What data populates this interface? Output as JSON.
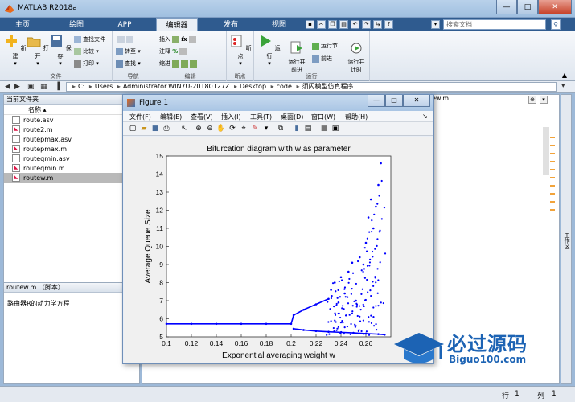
{
  "window": {
    "title": "MATLAB R2018a",
    "minimize": "—",
    "maximize": "□",
    "close": "✕"
  },
  "tabs": [
    {
      "label": "主页"
    },
    {
      "label": "绘图"
    },
    {
      "label": "APP"
    },
    {
      "label": "编辑器"
    },
    {
      "label": "发布"
    },
    {
      "label": "视图"
    }
  ],
  "search": {
    "placeholder": "搜索文档"
  },
  "ribbon": {
    "file": {
      "title": "文件",
      "new": "新建",
      "open": "打开",
      "save": "保存",
      "find_files": "查找文件",
      "compare": "比较",
      "print": "打印"
    },
    "nav": {
      "title": "导航",
      "goto": "转至",
      "find": "查找"
    },
    "edit": {
      "title": "编辑",
      "insert": "插入",
      "comment": "注释",
      "indent": "缩进",
      "fx": "fx"
    },
    "breakpoints": {
      "title": "断点",
      "label": "断点"
    },
    "run": {
      "title": "运行",
      "run": "运行",
      "run_advance": "运行并\n前进",
      "run_section": "运行节",
      "advance": "前进",
      "run_time": "运行并\n计时"
    }
  },
  "path": {
    "segments": [
      "C:",
      "Users",
      "Administrator.WIN7U-20180127Z",
      "Desktop",
      "code",
      "须闪模型仿真程序"
    ]
  },
  "current_folder": {
    "title": "当前文件夹",
    "column": "名称",
    "files": [
      {
        "name": "route.asv",
        "type": "asv"
      },
      {
        "name": "route2.m",
        "type": "m"
      },
      {
        "name": "routepmax.asv",
        "type": "asv"
      },
      {
        "name": "routepmax.m",
        "type": "m"
      },
      {
        "name": "routeqmin.asv",
        "type": "asv"
      },
      {
        "name": "routeqmin.m",
        "type": "m"
      },
      {
        "name": "routew.m",
        "type": "m"
      }
    ],
    "detail_title": "routew.m （脚本）",
    "detail_text": "路由器R的动力学方程"
  },
  "editor": {
    "tab": "ew.m"
  },
  "right_strip": "工作区",
  "status": {
    "row_label": "行",
    "row": "1",
    "col_label": "列",
    "col": "1"
  },
  "figure": {
    "title": "Figure 1",
    "menu": [
      "文件(F)",
      "编辑(E)",
      "查看(V)",
      "插入(I)",
      "工具(T)",
      "桌面(D)",
      "窗口(W)",
      "帮助(H)"
    ]
  },
  "chart_data": {
    "type": "scatter",
    "title": "Bifurcation diagram with w as parameter",
    "xlabel": "Exponential averaging weight w",
    "ylabel": "Average Queue Size",
    "xlim": [
      0.1,
      0.28
    ],
    "ylim": [
      5,
      15
    ],
    "xticks": [
      "0.1",
      "0.12",
      "0.14",
      "0.16",
      "0.18",
      "0.2",
      "0.22",
      "0.24",
      "0.26"
    ],
    "yticks": [
      "5",
      "6",
      "7",
      "8",
      "9",
      "10",
      "11",
      "12",
      "13",
      "14",
      "15"
    ],
    "grid": false,
    "color": "#0000ff",
    "series": [
      {
        "x": [
          0.1,
          0.12,
          0.14,
          0.16,
          0.18,
          0.2,
          0.202,
          0.21,
          0.22,
          0.23
        ],
        "y": [
          5.72,
          5.72,
          5.72,
          5.72,
          5.72,
          5.72,
          6.2,
          6.5,
          6.8,
          7.1
        ]
      },
      {
        "x": [
          0.202,
          0.21,
          0.22,
          0.23,
          0.24,
          0.25,
          0.26,
          0.27,
          0.275
        ],
        "y": [
          5.45,
          5.38,
          5.32,
          5.28,
          5.25,
          5.22,
          5.18,
          5.15,
          5.12
        ]
      },
      {
        "x": [
          0.232,
          0.235,
          0.238,
          0.24,
          0.243,
          0.246,
          0.249,
          0.252,
          0.255,
          0.258,
          0.26,
          0.262,
          0.264,
          0.266,
          0.268,
          0.27,
          0.272
        ],
        "y": [
          7.6,
          8.0,
          6.9,
          8.3,
          7.4,
          8.6,
          9.1,
          7.0,
          9.4,
          9.0,
          10.2,
          11.6,
          12.6,
          11.0,
          12.2,
          13.4,
          14.6
        ]
      }
    ]
  },
  "watermark": {
    "cn": "必过源码",
    "en": "Biguo100.com"
  }
}
